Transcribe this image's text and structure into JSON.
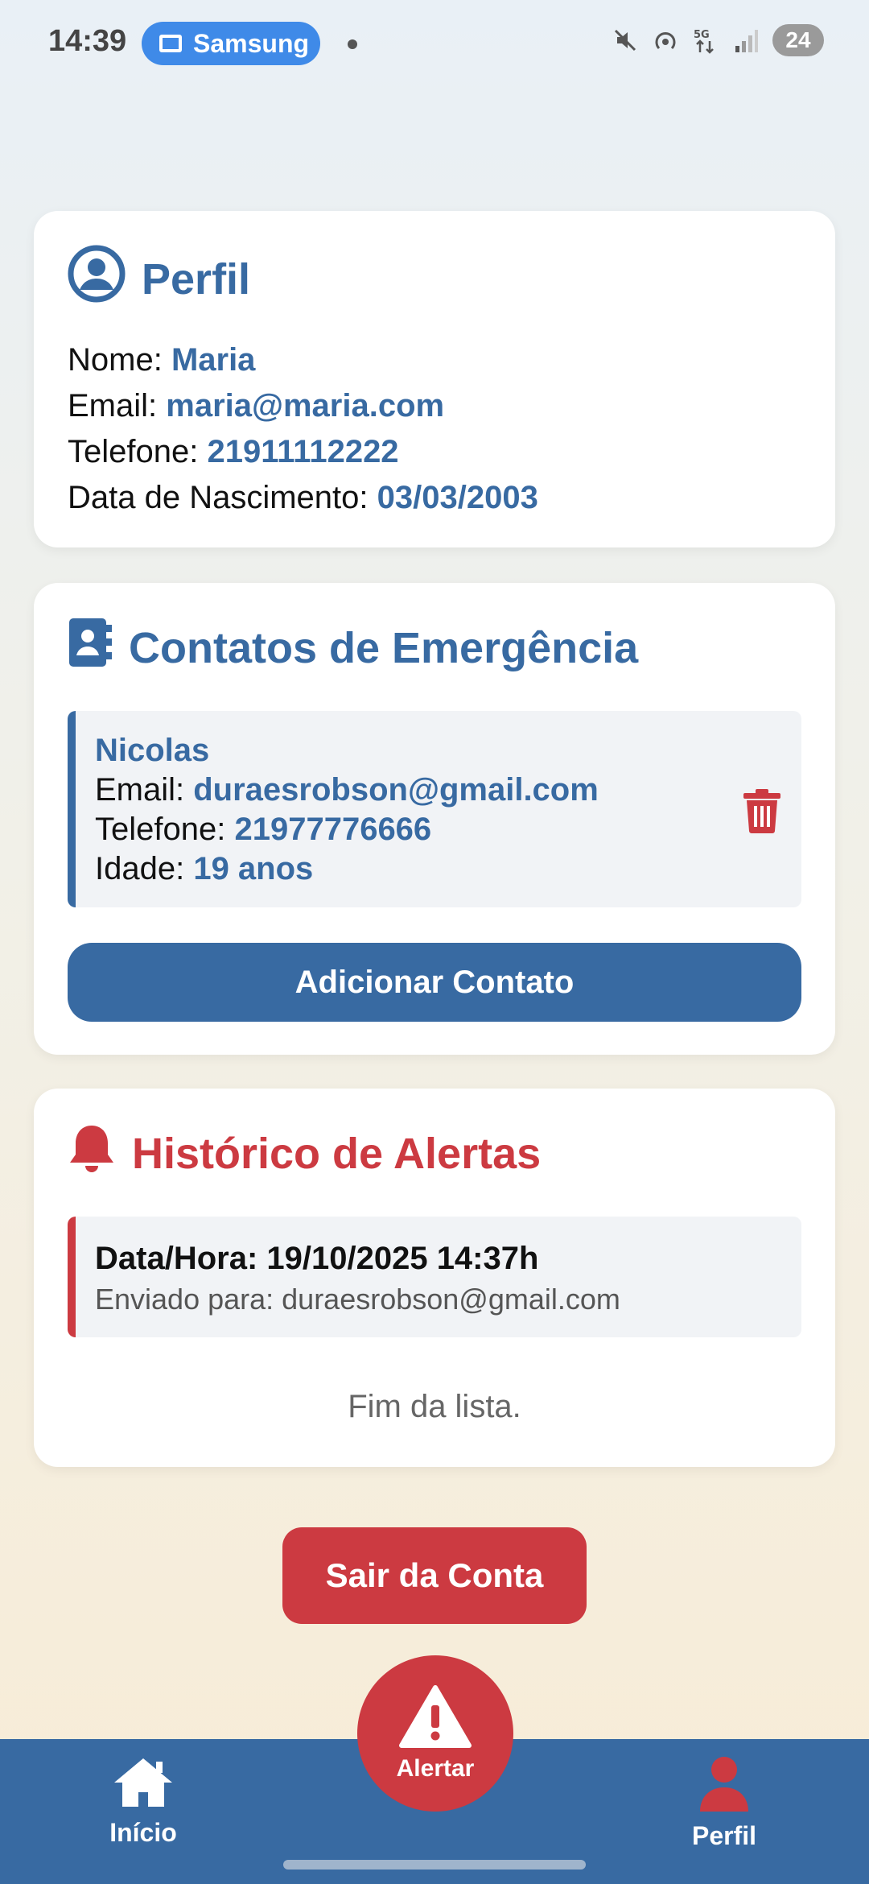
{
  "status_bar": {
    "time": "14:39",
    "pill_label": "Samsung",
    "battery": "24"
  },
  "profile": {
    "title": "Perfil",
    "name_label": "Nome: ",
    "name": "Maria",
    "email_label": "Email: ",
    "email": "maria@maria.com",
    "phone_label": "Telefone: ",
    "phone": "21911112222",
    "birth_label": "Data de Nascimento: ",
    "birth": "03/03/2003"
  },
  "contacts": {
    "title": "Contatos de Emergência",
    "items": [
      {
        "name": "Nicolas",
        "email_label": "Email: ",
        "email": "duraesrobson@gmail.com",
        "phone_label": "Telefone: ",
        "phone": "21977776666",
        "age_label": "Idade: ",
        "age": "19 anos"
      }
    ],
    "add_button": "Adicionar Contato"
  },
  "alerts": {
    "title": "Histórico de Alertas",
    "items": [
      {
        "datetime": "Data/Hora: 19/10/2025 14:37h",
        "sent_to": "Enviado para: duraesrobson@gmail.com"
      }
    ],
    "end_text": "Fim da lista."
  },
  "logout_button": "Sair da Conta",
  "nav": {
    "home": "Início",
    "alert": "Alertar",
    "profile": "Perfil"
  },
  "colors": {
    "primary": "#386aa2",
    "danger": "#cc3a41"
  }
}
